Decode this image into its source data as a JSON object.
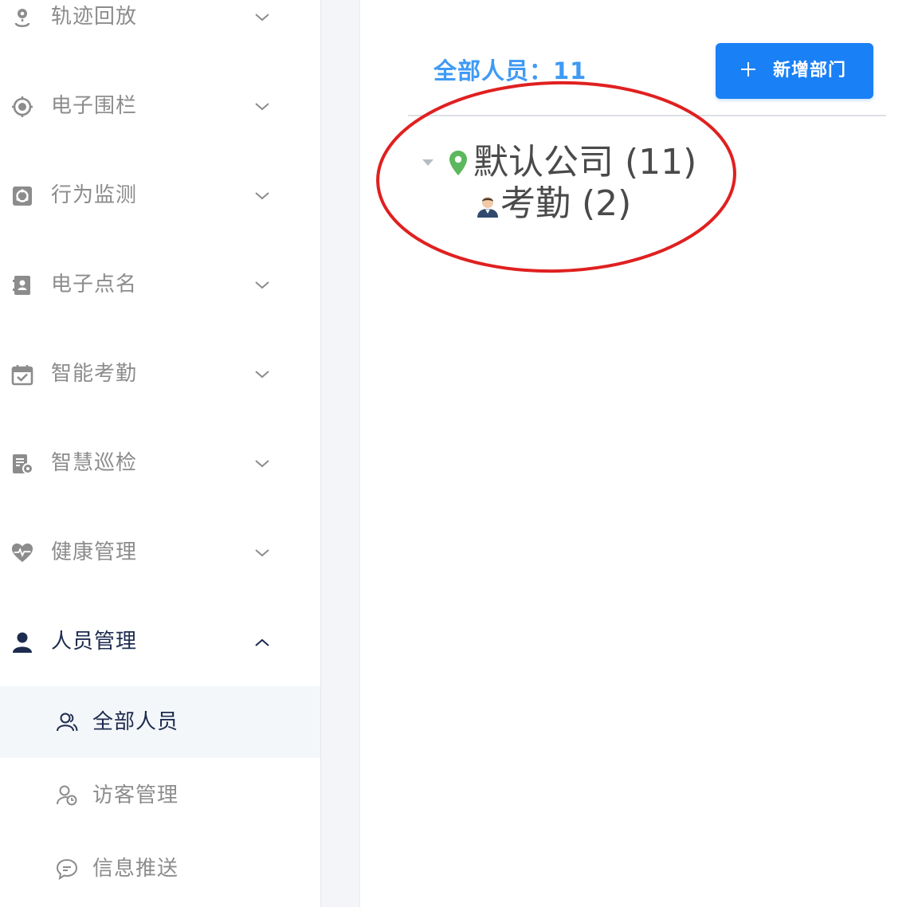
{
  "sidebar": {
    "menu": [
      {
        "label": "轨迹回放",
        "icon": "route-pin-icon"
      },
      {
        "label": "电子围栏",
        "icon": "target-icon"
      },
      {
        "label": "行为监测",
        "icon": "monitor-icon"
      },
      {
        "label": "电子点名",
        "icon": "contact-card-icon"
      },
      {
        "label": "智能考勤",
        "icon": "calendar-check-icon"
      },
      {
        "label": "智慧巡检",
        "icon": "document-pin-icon"
      },
      {
        "label": "健康管理",
        "icon": "heartbeat-icon"
      },
      {
        "label": "人员管理",
        "icon": "user-icon",
        "expanded": true
      }
    ],
    "submenu": [
      {
        "label": "全部人员",
        "icon": "users-icon",
        "selected": true
      },
      {
        "label": "访客管理",
        "icon": "visitor-icon"
      },
      {
        "label": "信息推送",
        "icon": "chat-bubble-icon"
      }
    ]
  },
  "main": {
    "total_label": "全部人员：11",
    "add_button_label": "新增部门",
    "tree": {
      "root": {
        "label": "默认公司 (11)",
        "icon": "location-pin-icon",
        "expanded": true
      },
      "children": [
        {
          "label": "考勤 (2)",
          "icon": "person-avatar-icon"
        }
      ]
    }
  },
  "colors": {
    "accent": "#1a80f5",
    "count_text": "#3f9af5",
    "pin": "#5cb85c",
    "annotation": "#e02020",
    "menu_text": "#8c8c8c",
    "active_text": "#1d2b4f",
    "selected_bg": "#f4f7fa"
  }
}
